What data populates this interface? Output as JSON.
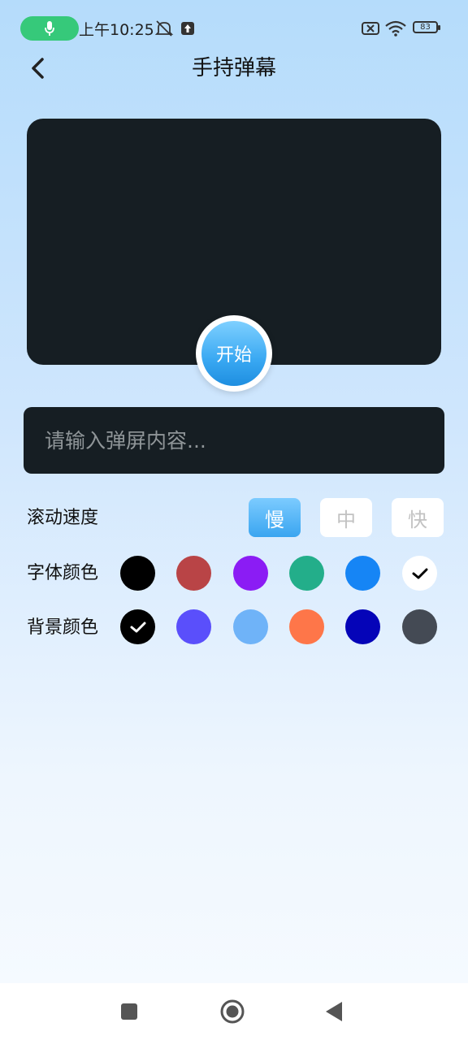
{
  "status_bar": {
    "time": "上午10:25",
    "battery": "83"
  },
  "header": {
    "title": "手持弹幕"
  },
  "preview": {
    "start_label": "开始"
  },
  "input": {
    "placeholder": "请输入弹屏内容...",
    "value": ""
  },
  "speed": {
    "label": "滚动速度",
    "options": [
      "慢",
      "中",
      "快"
    ],
    "selected": "慢"
  },
  "font_color": {
    "label": "字体颜色",
    "swatches": [
      "#000000",
      "#b94446",
      "#8b1cf4",
      "#23ae8a",
      "#1685f5",
      "#ffffff"
    ],
    "selected": "#ffffff"
  },
  "bg_color": {
    "label": "背景颜色",
    "swatches": [
      "#000000",
      "#5a4ffb",
      "#6fb3f8",
      "#fe7649",
      "#0504b8",
      "#444a54"
    ],
    "selected": "#000000"
  },
  "colors": {
    "accent": "#3aa5f0",
    "dark_panel": "#161e23"
  }
}
